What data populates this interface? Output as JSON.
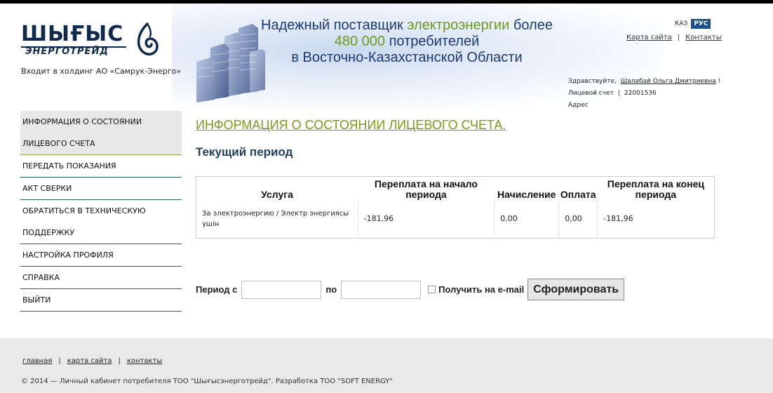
{
  "logo": {
    "main": "ШЫҒЫС",
    "sub": "ЭНЕРГОТРЕЙД"
  },
  "holding": "Входит в холдинг АО «Самрук-Энерго»",
  "slogan": {
    "line1_a": "Надежный поставщик ",
    "line1_green": "электроэнергии",
    "line1_b": " более",
    "line2_green": "480 000",
    "line2_b": " потребителей",
    "line3": "в Восточно-Казахстанской Области"
  },
  "lang": {
    "kaz": "КАЗ",
    "rus": "РУС"
  },
  "toplinks": {
    "sitemap": "Карта сайта",
    "contacts": "Контакты"
  },
  "user": {
    "greeting": "Здравствуйте,",
    "name": "Шалабай Ольга Дмитриевна",
    "exclaim": "!",
    "account_label": "Лицевой счет",
    "account_value": "22001536",
    "address_label": "Адрес"
  },
  "sidebar": {
    "items": [
      {
        "label": "ИНФОРМАЦИЯ О СОСТОЯНИИ",
        "label2": "ЛИЦЕВОГО СЧЕТА"
      },
      {
        "label": "ПЕРЕДАТЬ ПОКАЗАНИЯ"
      },
      {
        "label": "АКТ СВЕРКИ"
      },
      {
        "label": "ОБРАТИТЬСЯ В ТЕХНИЧЕСКУЮ",
        "label2": "ПОДДЕРЖКУ"
      },
      {
        "label": "НАСТРОЙКА ПРОФИЛЯ"
      },
      {
        "label": "СПРАВКА"
      },
      {
        "label": "ВЫЙТИ"
      }
    ]
  },
  "main": {
    "title": "ИНФОРМАЦИЯ О СОСТОЯНИИ ЛИЦЕВОГО СЧЕТА.",
    "section": "Текущий период",
    "table": {
      "headers": [
        "Услуга",
        "Переплата на начало периода",
        "Начисление",
        "Оплата",
        "Переплата на конец периода"
      ],
      "rows": [
        [
          "За электроэнергию / Электр энергиясы үшін",
          "-181,96",
          "0,00",
          "0,00",
          "-181,96"
        ]
      ]
    },
    "period": {
      "from_label": "Период с",
      "to_label": "по",
      "from_value": "",
      "to_value": "",
      "email_label": "Получить на e-mail",
      "submit": "Сформировать"
    }
  },
  "footer": {
    "links": [
      "главная",
      "карта сайта",
      "контакты"
    ],
    "copyright": "© 2014 — Личный кабинет потребителя ТОО \"Шығысэнерготрейд\". Разработка ТОО \"SOFT ENERGY\""
  },
  "colors": {
    "brand_dark": "#0f2a4d",
    "accent_green": "#7a9a1b",
    "nav_border": "#2c5d6b",
    "lang_active": "#1b4f8c"
  }
}
